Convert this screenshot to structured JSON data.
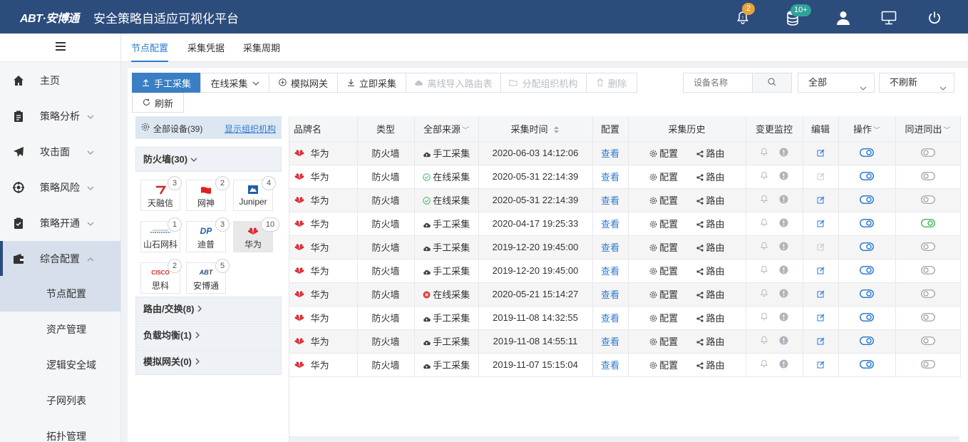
{
  "app": {
    "logo": "ABT·安博通",
    "title": "安全策略自适应可视化平台"
  },
  "header": {
    "alert_badge": "2",
    "db_badge": "10+",
    "colors": {
      "bar": "#2c4c7c",
      "alert_badge": "#e8a33b",
      "db_badge": "#2fa39a"
    }
  },
  "sidebar": {
    "items": [
      {
        "label": "主页",
        "icon": "home-icon"
      },
      {
        "label": "策略分析",
        "icon": "clipboard-icon",
        "caret": "﹀"
      },
      {
        "label": "攻击面",
        "icon": "send-icon",
        "caret": "﹀"
      },
      {
        "label": "策略风险",
        "icon": "target-icon",
        "caret": "﹀"
      },
      {
        "label": "策略开通",
        "icon": "checklist-icon",
        "caret": "﹀"
      },
      {
        "label": "综合配置",
        "icon": "wallet-icon",
        "caret": "︿"
      }
    ],
    "sub_items": [
      "节点配置",
      "资产管理",
      "逻辑安全域",
      "子网列表",
      "拓扑管理"
    ]
  },
  "tabs": [
    "节点配置",
    "采集凭据",
    "采集周期"
  ],
  "toolbar": {
    "manual": "手工采集",
    "online": "在线采集",
    "sim_gateway": "模拟网关",
    "collect_now": "立即采集",
    "offline_import": "离线导入路由表",
    "assign_org": "分配组织机构",
    "delete": "删除",
    "refresh": "刷新",
    "search_placeholder": "设备名称",
    "filter_all": "全部",
    "refresh_mode": "不刷新"
  },
  "tree": {
    "all_devices": "全部设备(39)",
    "show_org": "显示组织机构",
    "firewall": "防火墙(30)",
    "vendors": [
      {
        "name": "天融信",
        "count": "3"
      },
      {
        "name": "网神",
        "count": "2"
      },
      {
        "name": "Juniper",
        "count": "4"
      },
      {
        "name": "山石网科",
        "count": "1"
      },
      {
        "name": "迪普",
        "count": "3"
      },
      {
        "name": "华为",
        "count": "10"
      },
      {
        "name": "思科",
        "count": "2"
      },
      {
        "name": "安博通",
        "count": "5"
      }
    ],
    "vendor_logos": {
      "dp": "DP",
      "abt": "ABT",
      "cisco": "CISCO",
      "huawei": "HUAWEI"
    },
    "groups": [
      "路由/交换(8)",
      "负载均衡(1)",
      "模拟网关(0)"
    ]
  },
  "table": {
    "headers": {
      "brand": "品牌名",
      "type": "类型",
      "source": "全部来源",
      "time": "采集时间",
      "config": "配置",
      "history": "采集历史",
      "monitor": "变更监控",
      "edit": "编辑",
      "ops": "操作",
      "sync": "同进同出"
    },
    "view_label": "查看",
    "hist_config": "配置",
    "hist_route": "路由",
    "rows": [
      {
        "brand": "华为",
        "type": "防火墙",
        "source": "手工采集",
        "status": "cloud",
        "time": "2020-06-03 14:12:06",
        "edit_on": true,
        "sync_on": false
      },
      {
        "brand": "华为",
        "type": "防火墙",
        "source": "在线采集",
        "status": "ok",
        "time": "2020-05-31 22:14:39",
        "edit_on": false,
        "sync_on": false
      },
      {
        "brand": "华为",
        "type": "防火墙",
        "source": "在线采集",
        "status": "ok",
        "time": "2020-05-31 22:14:39",
        "edit_on": true,
        "sync_on": false
      },
      {
        "brand": "华为",
        "type": "防火墙",
        "source": "手工采集",
        "status": "cloud",
        "time": "2020-04-17 19:25:33",
        "edit_on": true,
        "sync_on": true
      },
      {
        "brand": "华为",
        "type": "防火墙",
        "source": "手工采集",
        "status": "cloud",
        "time": "2019-12-20 19:45:00",
        "edit_on": false,
        "sync_on": false
      },
      {
        "brand": "华为",
        "type": "防火墙",
        "source": "手工采集",
        "status": "cloud",
        "time": "2019-12-20 19:45:00",
        "edit_on": true,
        "sync_on": false
      },
      {
        "brand": "华为",
        "type": "防火墙",
        "source": "在线采集",
        "status": "error",
        "time": "2020-05-21 15:14:27",
        "edit_on": true,
        "sync_on": false
      },
      {
        "brand": "华为",
        "type": "防火墙",
        "source": "手工采集",
        "status": "cloud",
        "time": "2019-11-08 14:32:55",
        "edit_on": true,
        "sync_on": false
      },
      {
        "brand": "华为",
        "type": "防火墙",
        "source": "手工采集",
        "status": "cloud",
        "time": "2019-11-08 14:55:11",
        "edit_on": true,
        "sync_on": false
      },
      {
        "brand": "华为",
        "type": "防火墙",
        "source": "手工采集",
        "status": "cloud",
        "time": "2019-11-07 15:15:04",
        "edit_on": true,
        "sync_on": false
      }
    ]
  }
}
